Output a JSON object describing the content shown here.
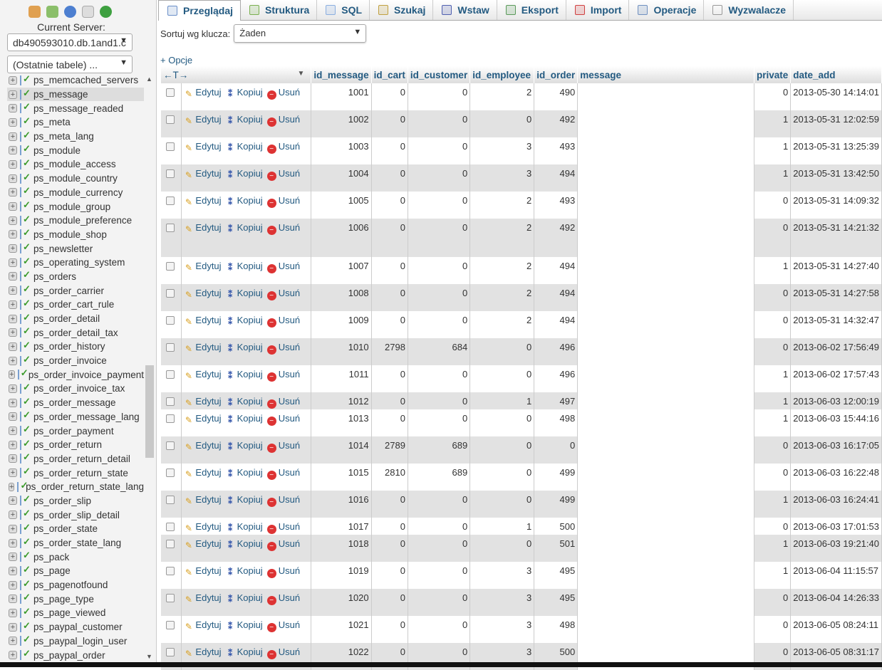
{
  "sidebar": {
    "server_label": "Current Server:",
    "server_value": "db490593010.db.1and1.c",
    "recent_tables": "(Ostatnie tabele) ...",
    "active": "ps_message",
    "tables": [
      "ps_memcached_servers",
      "ps_message",
      "ps_message_readed",
      "ps_meta",
      "ps_meta_lang",
      "ps_module",
      "ps_module_access",
      "ps_module_country",
      "ps_module_currency",
      "ps_module_group",
      "ps_module_preference",
      "ps_module_shop",
      "ps_newsletter",
      "ps_operating_system",
      "ps_orders",
      "ps_order_carrier",
      "ps_order_cart_rule",
      "ps_order_detail",
      "ps_order_detail_tax",
      "ps_order_history",
      "ps_order_invoice",
      "ps_order_invoice_payment",
      "ps_order_invoice_tax",
      "ps_order_message",
      "ps_order_message_lang",
      "ps_order_payment",
      "ps_order_return",
      "ps_order_return_detail",
      "ps_order_return_state",
      "ps_order_return_state_lang",
      "ps_order_slip",
      "ps_order_slip_detail",
      "ps_order_state",
      "ps_order_state_lang",
      "ps_pack",
      "ps_page",
      "ps_pagenotfound",
      "ps_page_type",
      "ps_page_viewed",
      "ps_paypal_customer",
      "ps_paypal_login_user",
      "ps_paypal_order"
    ]
  },
  "tabs": [
    {
      "label": "Przeglądaj",
      "icon": "browse-icon",
      "active": true
    },
    {
      "label": "Struktura",
      "icon": "structure-icon"
    },
    {
      "label": "SQL",
      "icon": "sql-icon"
    },
    {
      "label": "Szukaj",
      "icon": "search-icon"
    },
    {
      "label": "Wstaw",
      "icon": "insert-icon"
    },
    {
      "label": "Eksport",
      "icon": "export-icon"
    },
    {
      "label": "Import",
      "icon": "import-icon"
    },
    {
      "label": "Operacje",
      "icon": "wrench-icon"
    },
    {
      "label": "Wyzwalacze",
      "icon": "triggers-icon"
    }
  ],
  "sort": {
    "label": "Sortuj wg klucza:",
    "value": "Żaden"
  },
  "options_link": "+ Opcje",
  "actions": {
    "edit": "Edytuj",
    "copy": "Kopiuj",
    "delete": "Usuń"
  },
  "columns": [
    "id_message",
    "id_cart",
    "id_customer",
    "id_employee",
    "id_order",
    "message",
    "private",
    "date_add"
  ],
  "rows": [
    [
      1001,
      0,
      0,
      2,
      490,
      "",
      0,
      "2013-05-30 14:14:01"
    ],
    [
      1002,
      0,
      0,
      0,
      492,
      "",
      1,
      "2013-05-31 12:02:59"
    ],
    [
      1003,
      0,
      0,
      3,
      493,
      "",
      1,
      "2013-05-31 13:25:39"
    ],
    [
      1004,
      0,
      0,
      3,
      494,
      "",
      1,
      "2013-05-31 13:42:50"
    ],
    [
      1005,
      0,
      0,
      2,
      493,
      "",
      0,
      "2013-05-31 14:09:32"
    ],
    [
      1006,
      0,
      0,
      2,
      492,
      "",
      0,
      "2013-05-31 14:21:32"
    ],
    [
      1007,
      0,
      0,
      2,
      494,
      "",
      1,
      "2013-05-31 14:27:40"
    ],
    [
      1008,
      0,
      0,
      2,
      494,
      "",
      0,
      "2013-05-31 14:27:58"
    ],
    [
      1009,
      0,
      0,
      2,
      494,
      "",
      0,
      "2013-05-31 14:32:47"
    ],
    [
      1010,
      2798,
      684,
      0,
      496,
      "",
      0,
      "2013-06-02 17:56:49"
    ],
    [
      1011,
      0,
      0,
      0,
      496,
      "",
      1,
      "2013-06-02 17:57:43"
    ],
    [
      1012,
      0,
      0,
      1,
      497,
      "",
      1,
      "2013-06-03 12:00:19"
    ],
    [
      1013,
      0,
      0,
      0,
      498,
      "",
      1,
      "2013-06-03 15:44:16"
    ],
    [
      1014,
      2789,
      689,
      0,
      0,
      "",
      0,
      "2013-06-03 16:17:05"
    ],
    [
      1015,
      2810,
      689,
      0,
      499,
      "",
      0,
      "2013-06-03 16:22:48"
    ],
    [
      1016,
      0,
      0,
      0,
      499,
      "",
      1,
      "2013-06-03 16:24:41"
    ],
    [
      1017,
      0,
      0,
      1,
      500,
      "",
      0,
      "2013-06-03 17:01:53"
    ],
    [
      1018,
      0,
      0,
      0,
      501,
      "",
      1,
      "2013-06-03 19:21:40"
    ],
    [
      1019,
      0,
      0,
      3,
      495,
      "",
      1,
      "2013-06-04 11:15:57"
    ],
    [
      1020,
      0,
      0,
      3,
      495,
      "",
      0,
      "2013-06-04 14:26:33"
    ],
    [
      1021,
      0,
      0,
      3,
      498,
      "",
      0,
      "2013-06-05 08:24:11"
    ],
    [
      1022,
      0,
      0,
      3,
      500,
      "",
      0,
      "2013-06-05 08:31:17"
    ]
  ]
}
